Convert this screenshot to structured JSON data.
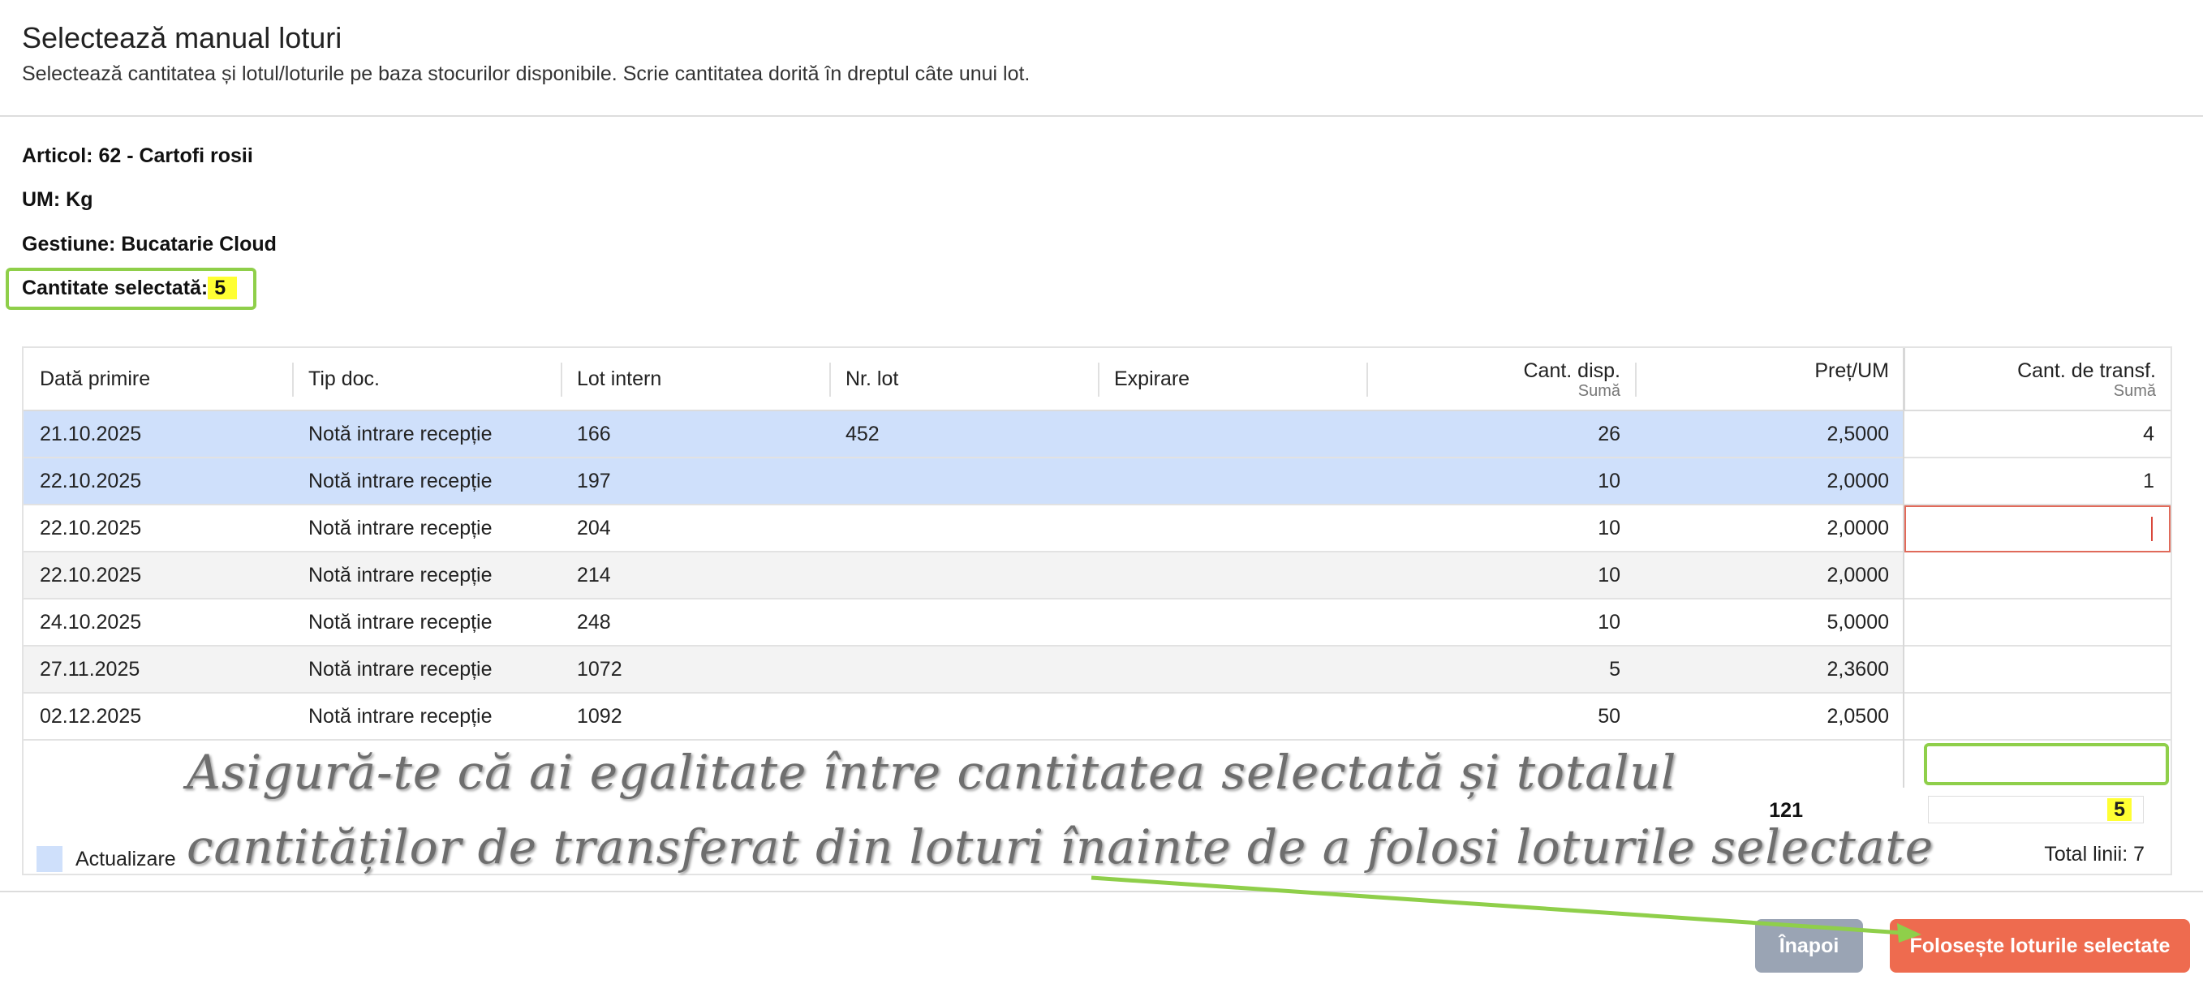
{
  "dialog": {
    "title": "Selectează manual loturi",
    "subtitle": "Selectează cantitatea și lotul/loturile pe baza stocurilor disponibile. Scrie cantitatea dorită în dreptul câte unui lot."
  },
  "info": {
    "articol": "Articol: 62 - Cartofi rosii",
    "um": "UM: Kg",
    "gestiune": "Gestiune: Bucatarie Cloud",
    "cantitate_label": "Cantitate selectată:",
    "cantitate_value": "5"
  },
  "table": {
    "columns": {
      "data_primire": "Dată primire",
      "tip_doc": "Tip doc.",
      "lot_intern": "Lot intern",
      "nr_lot": "Nr. lot",
      "expirare": "Expirare",
      "cant_disp": "Cant. disp.",
      "cant_disp_sub": "Sumă",
      "pret_um": "Preț/UM",
      "cant_transf": "Cant. de transf.",
      "cant_transf_sub": "Sumă"
    },
    "rows": [
      {
        "data": "21.10.2025",
        "tip": "Notă intrare recepție",
        "lot": "166",
        "nr_lot": "452",
        "expirare": "",
        "disp": "26",
        "pret": "2,5000",
        "transf": "4"
      },
      {
        "data": "22.10.2025",
        "tip": "Notă intrare recepție",
        "lot": "197",
        "nr_lot": "",
        "expirare": "",
        "disp": "10",
        "pret": "2,0000",
        "transf": "1"
      },
      {
        "data": "22.10.2025",
        "tip": "Notă intrare recepție",
        "lot": "204",
        "nr_lot": "",
        "expirare": "",
        "disp": "10",
        "pret": "2,0000",
        "transf": ""
      },
      {
        "data": "22.10.2025",
        "tip": "Notă intrare recepție",
        "lot": "214",
        "nr_lot": "",
        "expirare": "",
        "disp": "10",
        "pret": "2,0000",
        "transf": ""
      },
      {
        "data": "24.10.2025",
        "tip": "Notă intrare recepție",
        "lot": "248",
        "nr_lot": "",
        "expirare": "",
        "disp": "10",
        "pret": "5,0000",
        "transf": ""
      },
      {
        "data": "27.11.2025",
        "tip": "Notă intrare recepție",
        "lot": "1072",
        "nr_lot": "",
        "expirare": "",
        "disp": "5",
        "pret": "2,3600",
        "transf": ""
      },
      {
        "data": "02.12.2025",
        "tip": "Notă intrare recepție",
        "lot": "1092",
        "nr_lot": "",
        "expirare": "",
        "disp": "50",
        "pret": "2,0500",
        "transf": ""
      }
    ],
    "total_disp": "121",
    "total_transf": "5",
    "legend_label": "Actualizare",
    "total_linii": "Total linii: 7"
  },
  "annotation": {
    "line1": "Asigură-te că ai egalitate între cantitatea selectată și totalul",
    "line2": "cantităților de transferat din loturi înainte de a folosi loturile selectate"
  },
  "buttons": {
    "back": "Înapoi",
    "use": "Folosește loturile selectate"
  },
  "colors": {
    "selected_row": "#cfe0fb",
    "highlight": "#ffff33",
    "annotation_box": "#8fcf4a",
    "primary_button": "#ee6b4f",
    "secondary_button": "#9aa4b4"
  }
}
